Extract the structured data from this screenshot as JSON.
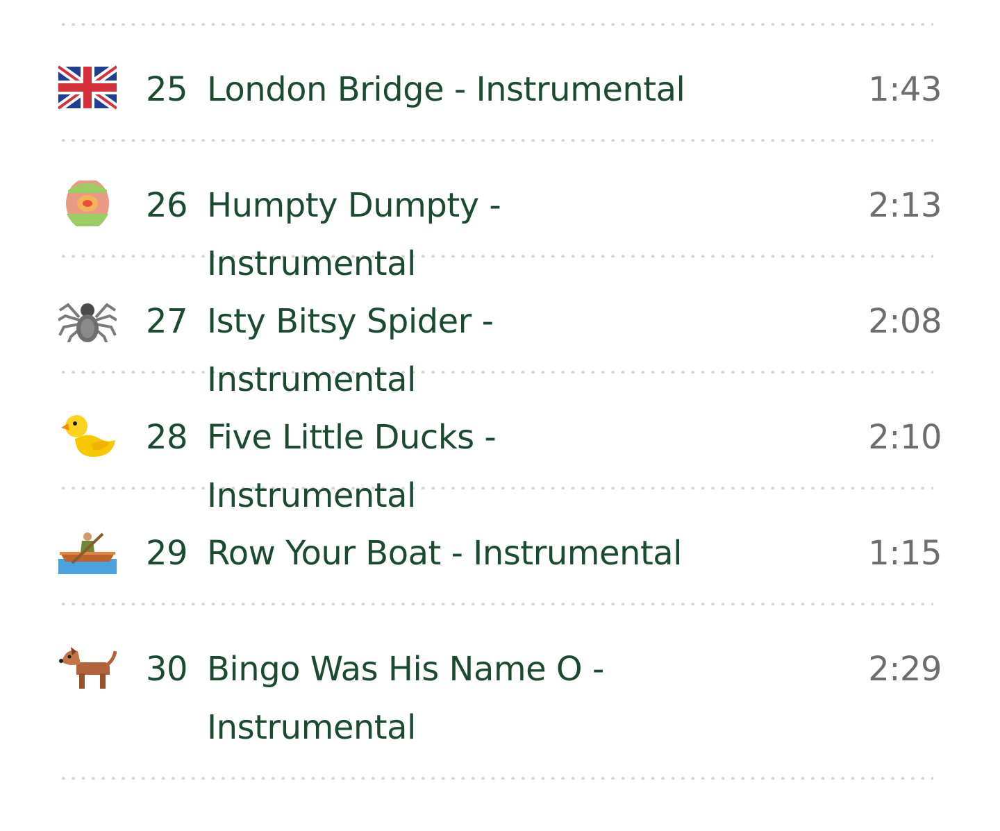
{
  "tracks": [
    {
      "number": "25",
      "title": "London Bridge - Instrumental",
      "duration": "1:43",
      "icon": "uk-flag-icon"
    },
    {
      "number": "26",
      "title": "Humpty Dumpty - Instrumental",
      "duration": "2:13",
      "icon": "egg-icon"
    },
    {
      "number": "27",
      "title": "Isty Bitsy Spider - Instrumental",
      "duration": "2:08",
      "icon": "spider-icon"
    },
    {
      "number": "28",
      "title": "Five Little Ducks - Instrumental",
      "duration": "2:10",
      "icon": "duck-icon"
    },
    {
      "number": "29",
      "title": "Row Your Boat - Instrumental",
      "duration": "1:15",
      "icon": "rowboat-icon"
    },
    {
      "number": "30",
      "title": "Bingo Was His Name O - Instrumental",
      "duration": "2:29",
      "icon": "dog-icon"
    }
  ],
  "colors": {
    "title": "#1b4a30",
    "duration": "#6a6f6c",
    "divider": "#d3d6d4"
  }
}
